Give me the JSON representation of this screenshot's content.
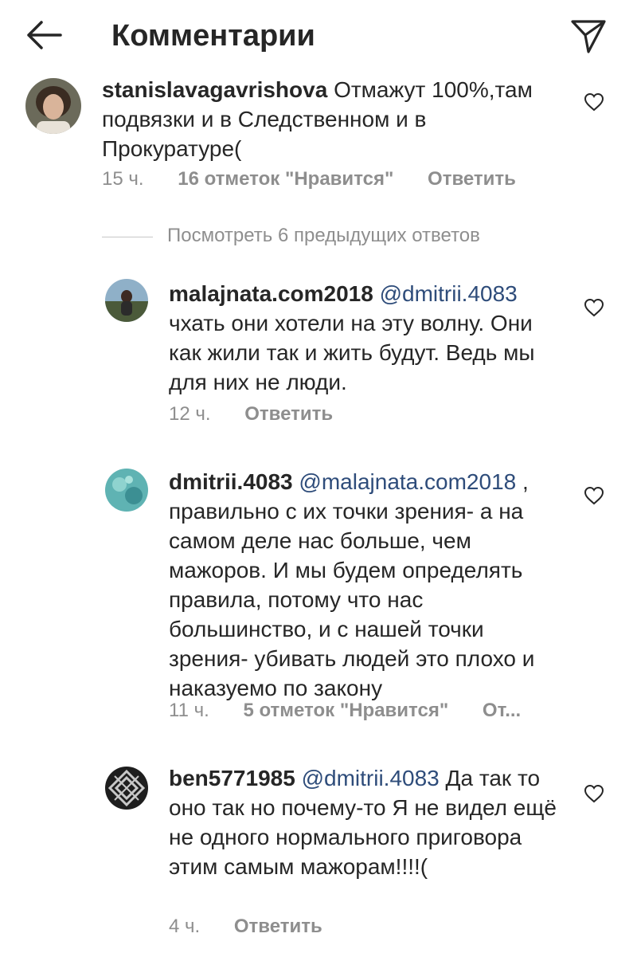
{
  "header": {
    "title": "Комментарии"
  },
  "comments": [
    {
      "username": "stanislavagavrishova",
      "mention": "",
      "text": "Отмажут 100%,там подвязки и в Следственном и в Прокуратуре(",
      "time": "15 ч.",
      "likes": "16 отметок \"Нравится\"",
      "reply": "Ответить"
    },
    {
      "username": "malajnata.com2018",
      "mention": "@dmitrii.4083",
      "text": "чхать они хотели на эту волну. Они как жили так и жить будут. Ведь мы для них не люди.",
      "time": "12 ч.",
      "likes": "",
      "reply": "Ответить"
    },
    {
      "username": "dmitrii.4083",
      "mention": "@malajnata.com2018",
      "text": ", правильно с их точки зрения- а на самом деле нас больше, чем мажоров. И мы  будем определять правила, потому что нас большинство, и с нашей точки зрения- убивать людей это плохо и наказуемо по закону",
      "time": "11 ч.",
      "likes": "5 отметок \"Нравится\"",
      "reply": "От..."
    },
    {
      "username": "ben5771985",
      "mention": "@dmitrii.4083",
      "text": "Да так то оно так но почему-то Я не видел ещё не одного нормального приговора этим самым мажорам!!!!(",
      "time": "4 ч.",
      "likes": "",
      "reply": "Ответить"
    }
  ],
  "view_replies": {
    "label": "Посмотреть 6 предыдущих ответов"
  },
  "icons": {
    "back": "arrow-left-icon",
    "send": "paper-plane-icon",
    "like": "heart-outline-icon"
  },
  "colors": {
    "text": "#262626",
    "secondary": "#8e8e8e",
    "mention": "#2e4c7a"
  }
}
